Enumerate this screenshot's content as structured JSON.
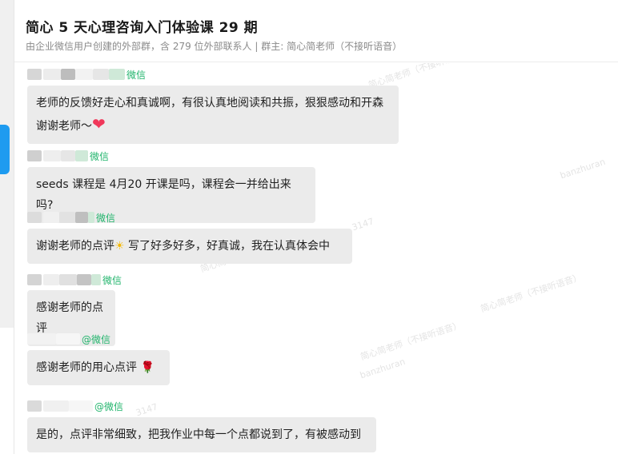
{
  "header": {
    "title": "简心 5 天心理咨询入门体验课 29 期",
    "subtitle": "由企业微信用户创建的外部群，含 279 位外部联系人 | 群主: 简心简老师（不接听语音）"
  },
  "wechat_label": "@微信",
  "wechat_label_short": "微信",
  "messages": [
    {
      "text": "老师的反馈好走心和真诚啊，有很认真地阅读和共振，狠狠感动和开森\n谢谢老师～",
      "emoji": "❤"
    },
    {
      "text": "seeds 课程是 4月20 开课是吗，课程会一并给出来吗?"
    },
    {
      "text_before": "谢谢老师的点评",
      "emoji": "☀",
      "text_after": " 写了好多好多，好真诚，我在认真体会中"
    },
    {
      "text": "感谢老师的点评"
    },
    {
      "text": "感谢老师的用心点评",
      "emoji": "🌹"
    },
    {
      "text": "是的，点评非常细致，把我作业中每一个点都说到了，有被感动到"
    }
  ],
  "watermark": {
    "line1": "简心简老师（不接听语音）",
    "line2": "banzhuran",
    "line3": "3147"
  },
  "colors": {
    "accent_blue": "#1e9bf0",
    "wechat_green": "#20b46b",
    "bubble_bg": "#ebebeb"
  }
}
